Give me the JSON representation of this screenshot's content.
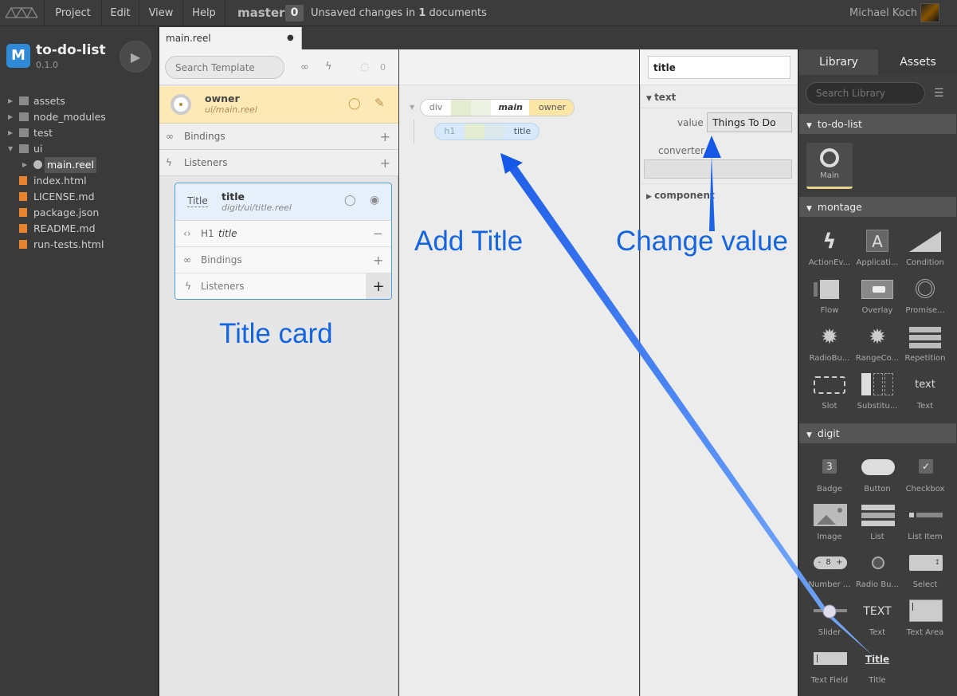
{
  "menubar": {
    "items": [
      "Project",
      "Edit",
      "View",
      "Help"
    ],
    "branch": "master",
    "change_count": "0",
    "unsaved_prefix": "Unsaved changes in ",
    "unsaved_count": "1",
    "unsaved_suffix": " documents",
    "user_name": "Michael Koch"
  },
  "project": {
    "name": "to-do-list",
    "version": "0.1.0",
    "icon_letter": "M"
  },
  "file_tree": [
    {
      "label": "assets",
      "type": "folder",
      "expanded": false,
      "depth": 0
    },
    {
      "label": "node_modules",
      "type": "folder",
      "expanded": false,
      "depth": 0
    },
    {
      "label": "test",
      "type": "folder",
      "expanded": false,
      "depth": 0
    },
    {
      "label": "ui",
      "type": "folder",
      "expanded": true,
      "depth": 0
    },
    {
      "label": "main.reel",
      "type": "reel",
      "expanded": false,
      "depth": 1,
      "selected": true
    },
    {
      "label": "index.html",
      "type": "file",
      "depth": 0
    },
    {
      "label": "LICENSE.md",
      "type": "file",
      "depth": 0
    },
    {
      "label": "package.json",
      "type": "file",
      "depth": 0
    },
    {
      "label": "README.md",
      "type": "file",
      "depth": 0
    },
    {
      "label": "run-tests.html",
      "type": "file",
      "depth": 0
    }
  ],
  "document_tab": {
    "label": "main.reel",
    "modified_marker": "●"
  },
  "template_panel": {
    "search_placeholder": "Search Template",
    "hidden_count": "0",
    "owner": {
      "label": "owner",
      "path": "ui/main.reel"
    },
    "bindings_label": "Bindings",
    "listeners_label": "Listeners"
  },
  "title_card": {
    "icon_text": "Title",
    "label": "title",
    "path": "digit/ui/title.reel",
    "element_tag": "H1",
    "element_name": "title",
    "bindings_label": "Bindings",
    "listeners_label": "Listeners"
  },
  "canvas": {
    "div_tag": "div",
    "div_label": "main",
    "div_owner": "owner",
    "h1_tag": "h1",
    "h1_label": "title"
  },
  "annotations": {
    "title_card": "Title card",
    "add_title": "Add Title",
    "change_value": "Change value"
  },
  "inspector": {
    "search_value": "title",
    "section_text": "text",
    "value_label": "value",
    "value": "Things To Do",
    "converter_label": "converter",
    "section_component": "component"
  },
  "library": {
    "tab_library": "Library",
    "tab_assets": "Assets",
    "search_placeholder": "Search Library",
    "section_project": "to-do-list",
    "project_items": [
      {
        "name": "Main",
        "icon": "reel-icon"
      }
    ],
    "section_montage": "montage",
    "montage_items": [
      {
        "name": "ActionEv...",
        "icon": "lightning-icon"
      },
      {
        "name": "Applicati...",
        "icon": "application-icon"
      },
      {
        "name": "Condition",
        "icon": "condition-icon"
      },
      {
        "name": "Flow",
        "icon": "flow-icon"
      },
      {
        "name": "Overlay",
        "icon": "overlay-icon"
      },
      {
        "name": "Promise...",
        "icon": "promise-icon"
      },
      {
        "name": "RadioBu...",
        "icon": "gear-icon"
      },
      {
        "name": "RangeCo...",
        "icon": "range-icon"
      },
      {
        "name": "Repetition",
        "icon": "repetition-icon"
      },
      {
        "name": "Slot",
        "icon": "slot-icon"
      },
      {
        "name": "Substitu...",
        "icon": "substitution-icon"
      },
      {
        "name": "Text",
        "icon": "text-icon"
      }
    ],
    "section_digit": "digit",
    "digit_items": [
      {
        "name": "Badge",
        "icon": "badge-icon",
        "glyph": "3"
      },
      {
        "name": "Button",
        "icon": "button-icon"
      },
      {
        "name": "Checkbox",
        "icon": "checkbox-icon",
        "glyph": "✓"
      },
      {
        "name": "Image",
        "icon": "image-icon"
      },
      {
        "name": "List",
        "icon": "list-icon"
      },
      {
        "name": "List Item",
        "icon": "list-item-icon"
      },
      {
        "name": "Number ...",
        "icon": "number-field-icon",
        "glyph": "8"
      },
      {
        "name": "Radio Bu...",
        "icon": "radio-button-icon"
      },
      {
        "name": "Select",
        "icon": "select-icon"
      },
      {
        "name": "Slider",
        "icon": "slider-icon"
      },
      {
        "name": "Text",
        "icon": "text-icon",
        "glyph": "TEXT"
      },
      {
        "name": "Text Area",
        "icon": "text-area-icon"
      },
      {
        "name": "Text Field",
        "icon": "text-field-icon"
      },
      {
        "name": "Title",
        "icon": "title-icon",
        "glyph": "Title"
      }
    ],
    "montage_text_glyph": "text"
  }
}
